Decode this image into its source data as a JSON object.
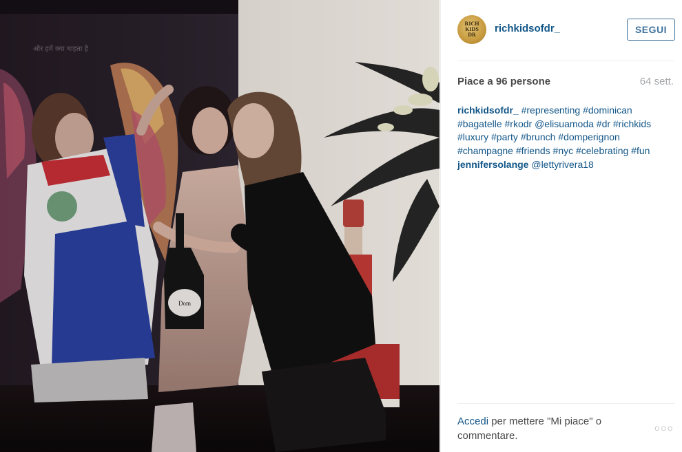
{
  "post": {
    "username": "richkidsofdr_",
    "avatar_text": "RICH\nKIDS\nDR",
    "follow_label": "SEGUI",
    "likes_text": "Piace a 96 persone",
    "time_ago": "64 sett.",
    "caption": {
      "username": "richkidsofdr_",
      "text": "#representing #dominican #bagatelle #rkodr @elisuamoda #dr #richkids #luxury #party #brunch #domperignon #champagne #friends #nyc #celebrating #fun"
    },
    "comments": [
      {
        "username": "jennifersolange",
        "text": "@lettyrivera18"
      }
    ],
    "footer": {
      "login_link": "Accedi",
      "login_text": " per mettere \"Mi piace\" o commentare."
    },
    "more_icon": "ellipsis-icon",
    "more_glyph": "○○○"
  },
  "photo": {
    "wall_text": "और हमें क्या चाहता है",
    "bottle_label": "Dom"
  },
  "colors": {
    "link": "#125688",
    "follow_border": "#3f729b",
    "muted": "#a5a7aa",
    "text": "#4a4a4a"
  }
}
